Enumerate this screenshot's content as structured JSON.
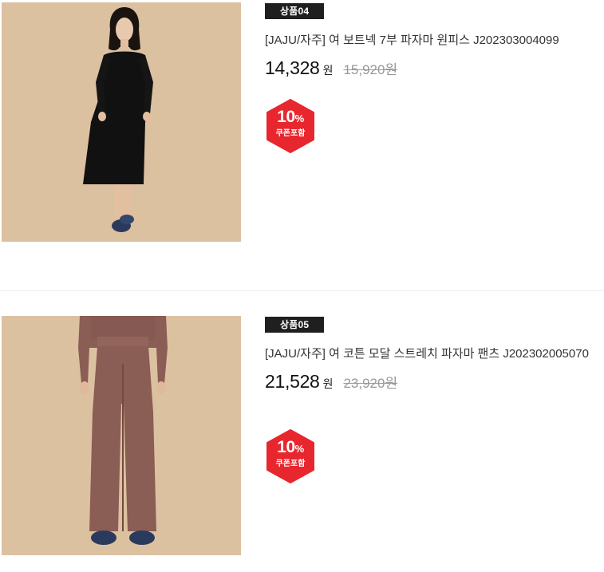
{
  "products": [
    {
      "tag": "상품04",
      "title": "[JAJU/자주] 여 보트넥 7부 파자마 원피스 J202303004099",
      "price": "14,328",
      "currency": "원",
      "original_price": "15,920원",
      "badge": {
        "percent": "10",
        "percent_sign": "%",
        "label": "쿠폰포함"
      },
      "image": {
        "subject": "black-dress-model",
        "background_color": "#dcc1a0",
        "garment_color": "#111111"
      }
    },
    {
      "tag": "상품05",
      "title": "[JAJU/자주] 여 코튼 모달 스트레치 파자마 팬츠 J202302005070",
      "price": "21,528",
      "currency": "원",
      "original_price": "23,920원",
      "badge": {
        "percent": "10",
        "percent_sign": "%",
        "label": "쿠폰포함"
      },
      "image": {
        "subject": "mauve-pajama-pants-model",
        "background_color": "#dcc1a0",
        "garment_color": "#8a5d55"
      }
    }
  ],
  "colors": {
    "tag_bg": "#1f1f1f",
    "badge_red": "#e8262e",
    "original_price": "#999999",
    "divider": "#ececec"
  }
}
